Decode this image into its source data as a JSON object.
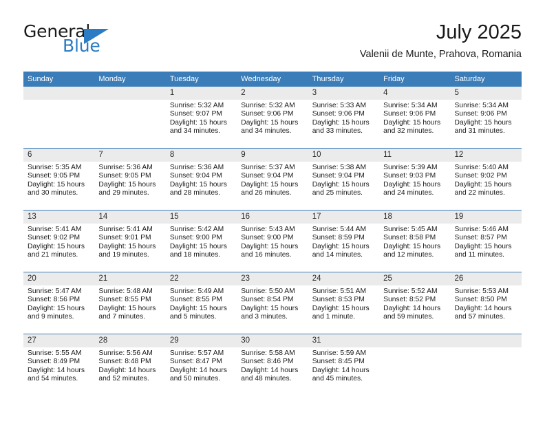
{
  "logo": {
    "word_top": "General",
    "word_bottom": "Blue",
    "triangle_color": "#2b7cc4"
  },
  "header": {
    "title": "July 2025",
    "subtitle": "Valenii de Munte, Prahova, Romania"
  },
  "theme": {
    "header_blue": "#3b7db9",
    "daynum_gray": "#ebebeb",
    "text_dark": "#1a1a1a"
  },
  "calendar": {
    "weekday_headers": [
      "Sunday",
      "Monday",
      "Tuesday",
      "Wednesday",
      "Thursday",
      "Friday",
      "Saturday"
    ],
    "weeks": [
      [
        {
          "day": "",
          "empty": true
        },
        {
          "day": "",
          "empty": true
        },
        {
          "day": "1",
          "sunrise": "Sunrise: 5:32 AM",
          "sunset": "Sunset: 9:07 PM",
          "daylight": "Daylight: 15 hours and 34 minutes."
        },
        {
          "day": "2",
          "sunrise": "Sunrise: 5:32 AM",
          "sunset": "Sunset: 9:06 PM",
          "daylight": "Daylight: 15 hours and 34 minutes."
        },
        {
          "day": "3",
          "sunrise": "Sunrise: 5:33 AM",
          "sunset": "Sunset: 9:06 PM",
          "daylight": "Daylight: 15 hours and 33 minutes."
        },
        {
          "day": "4",
          "sunrise": "Sunrise: 5:34 AM",
          "sunset": "Sunset: 9:06 PM",
          "daylight": "Daylight: 15 hours and 32 minutes."
        },
        {
          "day": "5",
          "sunrise": "Sunrise: 5:34 AM",
          "sunset": "Sunset: 9:06 PM",
          "daylight": "Daylight: 15 hours and 31 minutes."
        }
      ],
      [
        {
          "day": "6",
          "sunrise": "Sunrise: 5:35 AM",
          "sunset": "Sunset: 9:05 PM",
          "daylight": "Daylight: 15 hours and 30 minutes."
        },
        {
          "day": "7",
          "sunrise": "Sunrise: 5:36 AM",
          "sunset": "Sunset: 9:05 PM",
          "daylight": "Daylight: 15 hours and 29 minutes."
        },
        {
          "day": "8",
          "sunrise": "Sunrise: 5:36 AM",
          "sunset": "Sunset: 9:04 PM",
          "daylight": "Daylight: 15 hours and 28 minutes."
        },
        {
          "day": "9",
          "sunrise": "Sunrise: 5:37 AM",
          "sunset": "Sunset: 9:04 PM",
          "daylight": "Daylight: 15 hours and 26 minutes."
        },
        {
          "day": "10",
          "sunrise": "Sunrise: 5:38 AM",
          "sunset": "Sunset: 9:04 PM",
          "daylight": "Daylight: 15 hours and 25 minutes."
        },
        {
          "day": "11",
          "sunrise": "Sunrise: 5:39 AM",
          "sunset": "Sunset: 9:03 PM",
          "daylight": "Daylight: 15 hours and 24 minutes."
        },
        {
          "day": "12",
          "sunrise": "Sunrise: 5:40 AM",
          "sunset": "Sunset: 9:02 PM",
          "daylight": "Daylight: 15 hours and 22 minutes."
        }
      ],
      [
        {
          "day": "13",
          "sunrise": "Sunrise: 5:41 AM",
          "sunset": "Sunset: 9:02 PM",
          "daylight": "Daylight: 15 hours and 21 minutes."
        },
        {
          "day": "14",
          "sunrise": "Sunrise: 5:41 AM",
          "sunset": "Sunset: 9:01 PM",
          "daylight": "Daylight: 15 hours and 19 minutes."
        },
        {
          "day": "15",
          "sunrise": "Sunrise: 5:42 AM",
          "sunset": "Sunset: 9:00 PM",
          "daylight": "Daylight: 15 hours and 18 minutes."
        },
        {
          "day": "16",
          "sunrise": "Sunrise: 5:43 AM",
          "sunset": "Sunset: 9:00 PM",
          "daylight": "Daylight: 15 hours and 16 minutes."
        },
        {
          "day": "17",
          "sunrise": "Sunrise: 5:44 AM",
          "sunset": "Sunset: 8:59 PM",
          "daylight": "Daylight: 15 hours and 14 minutes."
        },
        {
          "day": "18",
          "sunrise": "Sunrise: 5:45 AM",
          "sunset": "Sunset: 8:58 PM",
          "daylight": "Daylight: 15 hours and 12 minutes."
        },
        {
          "day": "19",
          "sunrise": "Sunrise: 5:46 AM",
          "sunset": "Sunset: 8:57 PM",
          "daylight": "Daylight: 15 hours and 11 minutes."
        }
      ],
      [
        {
          "day": "20",
          "sunrise": "Sunrise: 5:47 AM",
          "sunset": "Sunset: 8:56 PM",
          "daylight": "Daylight: 15 hours and 9 minutes."
        },
        {
          "day": "21",
          "sunrise": "Sunrise: 5:48 AM",
          "sunset": "Sunset: 8:55 PM",
          "daylight": "Daylight: 15 hours and 7 minutes."
        },
        {
          "day": "22",
          "sunrise": "Sunrise: 5:49 AM",
          "sunset": "Sunset: 8:55 PM",
          "daylight": "Daylight: 15 hours and 5 minutes."
        },
        {
          "day": "23",
          "sunrise": "Sunrise: 5:50 AM",
          "sunset": "Sunset: 8:54 PM",
          "daylight": "Daylight: 15 hours and 3 minutes."
        },
        {
          "day": "24",
          "sunrise": "Sunrise: 5:51 AM",
          "sunset": "Sunset: 8:53 PM",
          "daylight": "Daylight: 15 hours and 1 minute."
        },
        {
          "day": "25",
          "sunrise": "Sunrise: 5:52 AM",
          "sunset": "Sunset: 8:52 PM",
          "daylight": "Daylight: 14 hours and 59 minutes."
        },
        {
          "day": "26",
          "sunrise": "Sunrise: 5:53 AM",
          "sunset": "Sunset: 8:50 PM",
          "daylight": "Daylight: 14 hours and 57 minutes."
        }
      ],
      [
        {
          "day": "27",
          "sunrise": "Sunrise: 5:55 AM",
          "sunset": "Sunset: 8:49 PM",
          "daylight": "Daylight: 14 hours and 54 minutes."
        },
        {
          "day": "28",
          "sunrise": "Sunrise: 5:56 AM",
          "sunset": "Sunset: 8:48 PM",
          "daylight": "Daylight: 14 hours and 52 minutes."
        },
        {
          "day": "29",
          "sunrise": "Sunrise: 5:57 AM",
          "sunset": "Sunset: 8:47 PM",
          "daylight": "Daylight: 14 hours and 50 minutes."
        },
        {
          "day": "30",
          "sunrise": "Sunrise: 5:58 AM",
          "sunset": "Sunset: 8:46 PM",
          "daylight": "Daylight: 14 hours and 48 minutes."
        },
        {
          "day": "31",
          "sunrise": "Sunrise: 5:59 AM",
          "sunset": "Sunset: 8:45 PM",
          "daylight": "Daylight: 14 hours and 45 minutes."
        },
        {
          "day": "",
          "empty": true
        },
        {
          "day": "",
          "empty": true
        }
      ]
    ]
  }
}
